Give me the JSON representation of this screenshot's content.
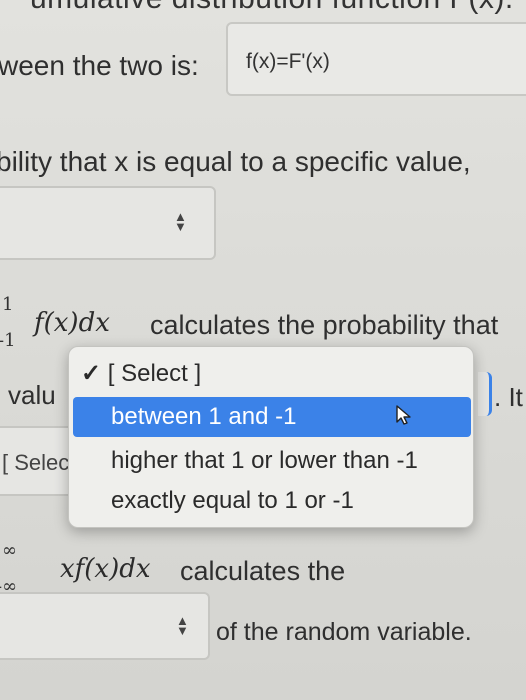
{
  "top_cut_text": "umulative distribution function F(x).",
  "relation_prefix": "ween the two is:",
  "relation_answer": "f(x)=F'(x)",
  "probability_line": "bility that x is equal to a specific value,",
  "integral_line": {
    "bound_upper": "1",
    "bound_lower": "-1",
    "expr": "f(x)dx",
    "text": "calculates the probability that"
  },
  "value_prefix": "valu",
  "after_select": ". It",
  "select_left_label": "[ Selec",
  "dropdown": {
    "checkmark": "✓",
    "options": [
      "[ Select ]",
      "between 1 and -1",
      "higher that 1 or lower than -1",
      "exactly equal to 1 or -1"
    ],
    "highlighted_index": 1
  },
  "expectation_line": {
    "bound_upper": "∞",
    "bound_lower": "-∞",
    "expr": "xf(x)dx",
    "text": "calculates the"
  },
  "random_variable_text": "of the random variable.",
  "colors": {
    "highlight": "#3b82e8",
    "background": "#dcdcd8"
  }
}
